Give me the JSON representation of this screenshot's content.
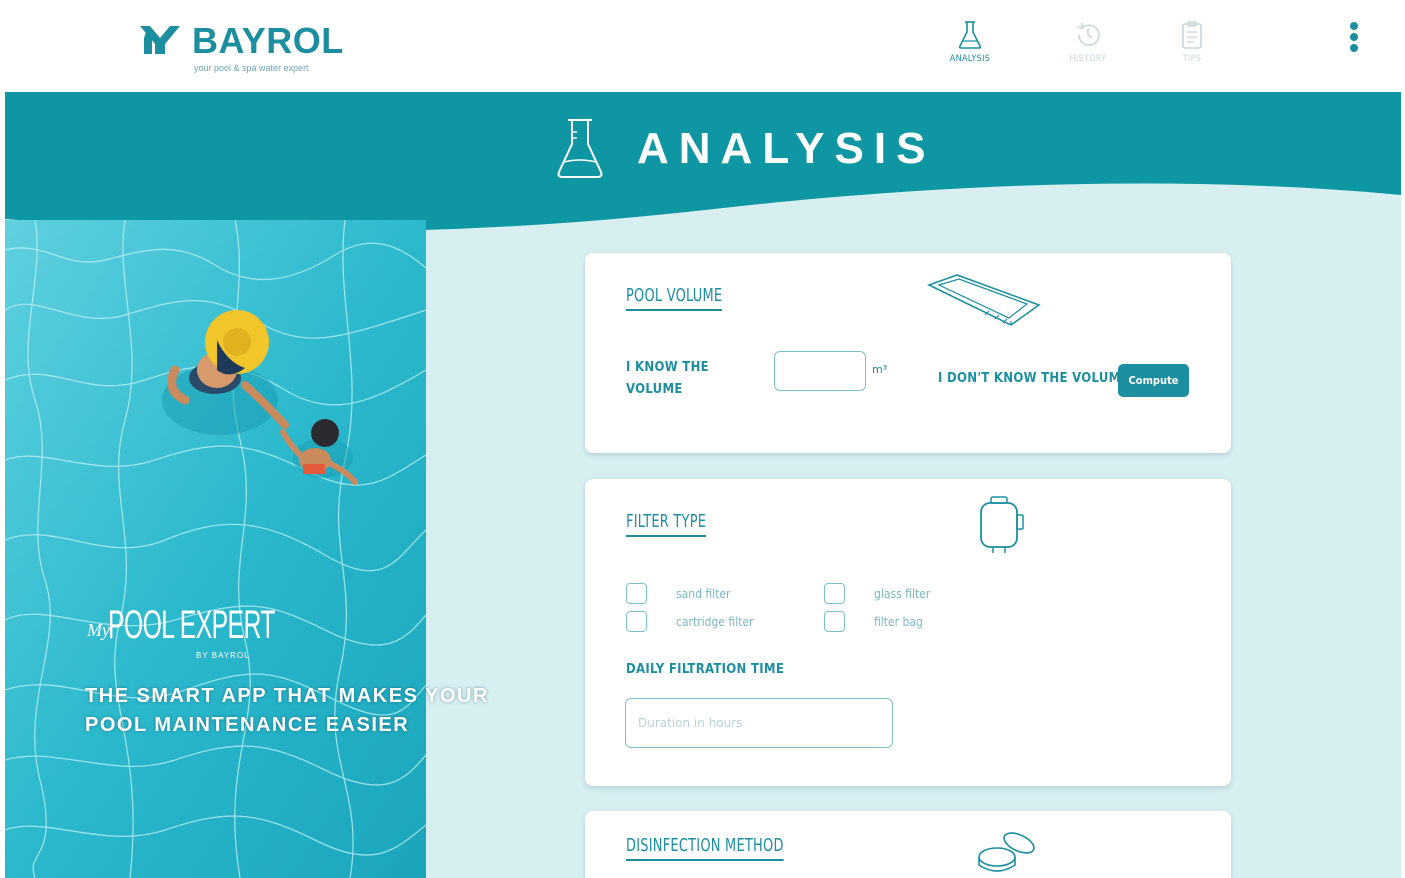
{
  "brand": {
    "name": "BAYROL",
    "tagline": "your pool & spa water expert"
  },
  "nav": {
    "items": [
      {
        "label": "ANALYSIS",
        "icon": "flask-icon",
        "active": true
      },
      {
        "label": "HISTORY",
        "icon": "history-icon",
        "active": false
      },
      {
        "label": "TIPS",
        "icon": "clipboard-icon",
        "active": false
      }
    ],
    "menu_icon": "more-vertical-icon"
  },
  "banner": {
    "title": "ANALYSIS",
    "icon": "flask-icon",
    "color": "#0e97a3"
  },
  "promo": {
    "brand_prefix": "My",
    "brand_name": "POOL EXPERT",
    "brand_by": "BY BAYROL",
    "tagline_line1": "THE SMART APP THAT MAKES YOUR",
    "tagline_line2": "POOL MAINTENANCE EASIER"
  },
  "pool_volume": {
    "title": "POOL VOLUME",
    "know_label_line1": "I KNOW THE",
    "know_label_line2": "VOLUME",
    "volume_value": "",
    "unit": "m³",
    "dont_know_label": "I DON'T KNOW THE VOLUME",
    "compute_button": "Compute"
  },
  "filter_type": {
    "title": "FILTER TYPE",
    "options": [
      {
        "label": "sand filter",
        "checked": false
      },
      {
        "label": "glass filter",
        "checked": false
      },
      {
        "label": "cartridge filter",
        "checked": false
      },
      {
        "label": "filter bag",
        "checked": false
      }
    ],
    "daily_filtration_label": "DAILY FILTRATION TIME",
    "daily_filtration_placeholder": "Duration in hours"
  },
  "disinfection": {
    "title": "DISINFECTION METHOD"
  },
  "colors": {
    "accent": "#1b8fa0",
    "banner": "#0e97a3",
    "background_light": "#d8eff2"
  }
}
